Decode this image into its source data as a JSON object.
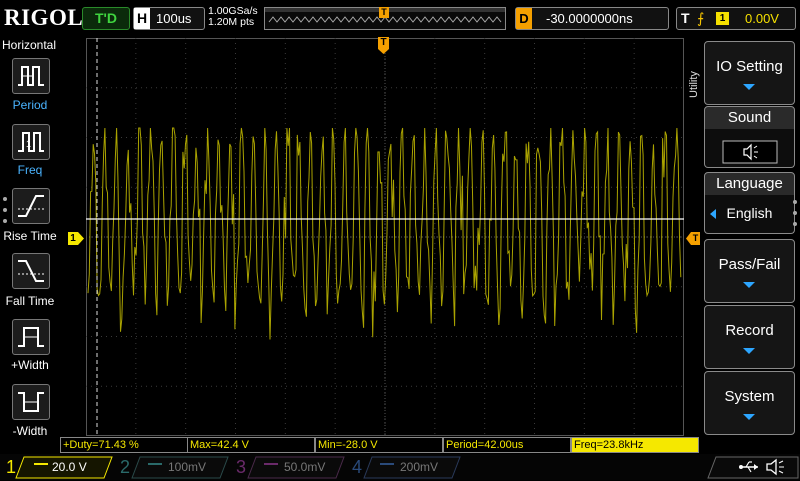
{
  "topbar": {
    "brand": "RIGOL",
    "run_state": "T'D",
    "horizontal_label": "H",
    "timebase": "100us",
    "sample_rate": "1.00GSa/s",
    "memory_depth": "1.20M pts",
    "memory_marker": "T",
    "delay_label": "D",
    "delay_value": "-30.0000000ns",
    "trigger_label": "T",
    "trigger_source": "1",
    "trigger_level": "0.00V"
  },
  "left_menu": {
    "title": "Horizontal",
    "items": [
      {
        "label": "Period",
        "icon": "period-icon",
        "active": true
      },
      {
        "label": "Freq",
        "icon": "freq-icon",
        "active": true
      },
      {
        "label": "Rise Time",
        "icon": "rise-time-icon",
        "active": false
      },
      {
        "label": "Fall Time",
        "icon": "fall-time-icon",
        "active": false
      },
      {
        "label": "+Width",
        "icon": "positive-width-icon",
        "active": false
      },
      {
        "label": "-Width",
        "icon": "negative-width-icon",
        "active": false
      }
    ]
  },
  "right_menu": {
    "side_label": "Utility",
    "io_setting": "IO Setting",
    "sound_title": "Sound",
    "language_title": "Language",
    "language_value": "English",
    "pass_fail": "Pass/Fail",
    "record": "Record",
    "system": "System"
  },
  "screen": {
    "channel_marker": "1",
    "trigger_marker": "T"
  },
  "measurements": [
    {
      "text": "+Duty=71.43 %",
      "highlight": false
    },
    {
      "text": "Max=42.4 V",
      "highlight": false
    },
    {
      "text": "Min=-28.0 V",
      "highlight": false
    },
    {
      "text": "Period=42.00us",
      "highlight": false
    },
    {
      "text": "Freq=23.8kHz",
      "highlight": true
    }
  ],
  "channels": [
    {
      "num": "1",
      "scale": "20.0 V",
      "color": "#f5e800",
      "active": true
    },
    {
      "num": "2",
      "scale": "100mV",
      "color": "#2fb0b0",
      "active": false
    },
    {
      "num": "3",
      "scale": "50.0mV",
      "color": "#c040c0",
      "active": false
    },
    {
      "num": "4",
      "scale": "200mV",
      "color": "#3a7ad0",
      "active": false
    }
  ],
  "colors": {
    "ch1": "#f5e800",
    "accent_blue": "#2da6ff",
    "trigger_orange": "#f5a000"
  },
  "status_icons": [
    "usb-icon",
    "speaker-icon"
  ]
}
